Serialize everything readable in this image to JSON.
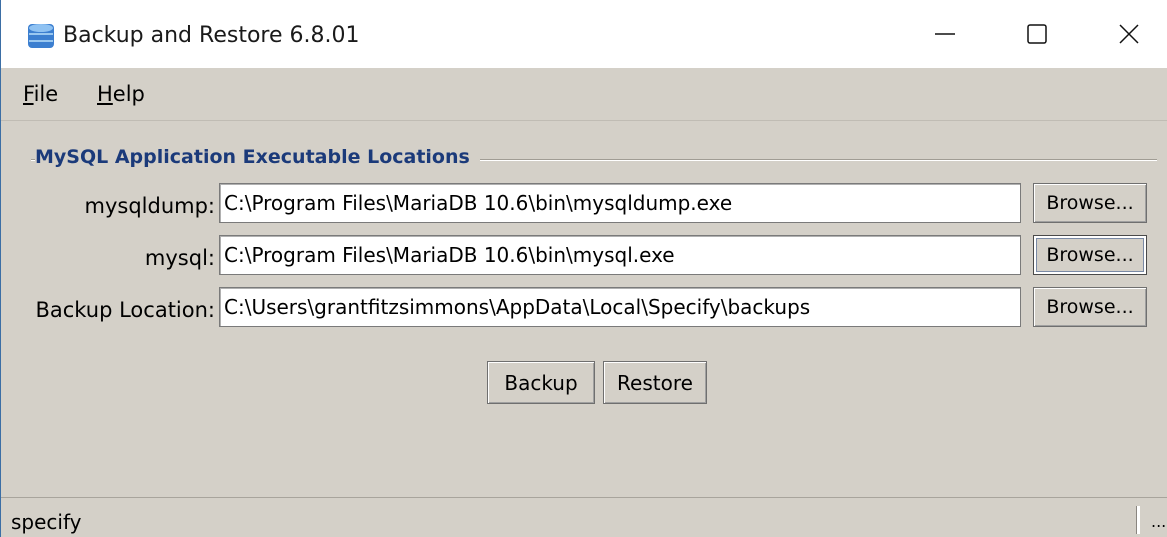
{
  "window": {
    "title": "Backup and Restore 6.8.01",
    "app_icon": "database-icon",
    "controls": {
      "minimize_icon": "minimize-icon",
      "maximize_icon": "maximize-icon",
      "close_icon": "close-icon"
    }
  },
  "menu": {
    "items": [
      {
        "first": "F",
        "rest": "ile"
      },
      {
        "first": "H",
        "rest": "elp"
      }
    ]
  },
  "section": {
    "title": "MySQL Application Executable Locations",
    "rows": [
      {
        "label": "mysqldump:",
        "value": "C:\\Program Files\\MariaDB 10.6\\bin\\mysqldump.exe",
        "button": "Browse..."
      },
      {
        "label": "mysql:",
        "value": "C:\\Program Files\\MariaDB 10.6\\bin\\mysql.exe",
        "button": "Browse..."
      },
      {
        "label": "Backup Location:",
        "value": "C:\\Users\\grantfitzsimmons\\AppData\\Local\\Specify\\backups",
        "button": "Browse..."
      }
    ]
  },
  "actions": {
    "backup": "Backup",
    "restore": "Restore"
  },
  "status": {
    "text": "specify",
    "ellipsis": "..."
  },
  "colors": {
    "window_bg": "#d4d0c8",
    "section_title": "#1b3a7a"
  }
}
